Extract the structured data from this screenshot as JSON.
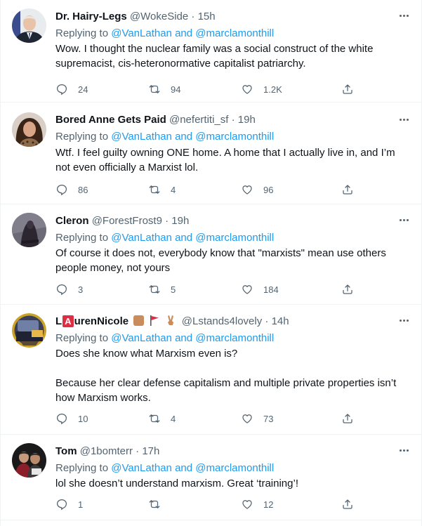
{
  "tweets": [
    {
      "display_name": "Dr. Hairy-Legs",
      "handle": "@WokeSide",
      "time": "15h",
      "replying_prefix": "Replying to",
      "reply_user1": "@VanLathan",
      "reply_and": "and",
      "reply_user2": "@marclamonthill",
      "text": [
        "Wow. I thought the nuclear family was a social construct of the white supremacist, cis-heteronormative capitalist patriarchy."
      ],
      "replies": "24",
      "retweets": "94",
      "likes": "1.2K",
      "avatar_icon": "man-in-suit-avatar"
    },
    {
      "display_name": "Bored Anne Gets Paid",
      "handle": "@nefertiti_sf",
      "time": "19h",
      "replying_prefix": "Replying to",
      "reply_user1": "@VanLathan",
      "reply_and": "and",
      "reply_user2": "@marclamonthill",
      "text": [
        "Wtf. I feel guilty owning ONE home. A home that I actually live in, and I’m not even officially a Marxist lol."
      ],
      "replies": "86",
      "retweets": "4",
      "likes": "96",
      "avatar_icon": "woman-avatar"
    },
    {
      "display_name": "Cleron",
      "handle": "@ForestFrost9",
      "time": "19h",
      "replying_prefix": "Replying to",
      "reply_user1": "@VanLathan",
      "reply_and": "and",
      "reply_user2": "@marclamonthill",
      "text": [
        "Of course it does not, everybody know that \"marxists\" mean use others people money, not yours"
      ],
      "replies": "3",
      "retweets": "5",
      "likes": "184",
      "avatar_icon": "dark-figure-avatar"
    },
    {
      "display_name_pre": "L",
      "display_name_badge": "A",
      "display_name_post": "urenNicole",
      "handle": "@Lstands4lovely",
      "time": "14h",
      "replying_prefix": "Replying to",
      "reply_user1": "@VanLathan",
      "reply_and": "and",
      "reply_user2": "@marclamonthill",
      "text": [
        "Does she know what Marxism even is?",
        "Because her clear defense capitalism and multiple private properties isn’t how Marxism works."
      ],
      "replies": "10",
      "retweets": "4",
      "likes": "73",
      "avatar_icon": "car-interior-avatar",
      "name_emojis": [
        "raised-fist-emoji",
        "red-flag-emoji",
        "victory-hand-emoji"
      ]
    },
    {
      "display_name": "Tom",
      "handle": "@1bomterr",
      "time": "17h",
      "replying_prefix": "Replying to",
      "reply_user1": "@VanLathan",
      "reply_and": "and",
      "reply_user2": "@marclamonthill",
      "text": [
        "lol she doesn’t understand marxism. Great ‘training’!"
      ],
      "replies": "1",
      "retweets": "",
      "likes": "12",
      "avatar_icon": "two-people-avatar"
    }
  ],
  "colors": {
    "link": "#1d9bf0",
    "muted": "#536471",
    "text": "#0f1419",
    "border": "#eff3f4"
  },
  "icons": {
    "reply": "reply-bubble-icon",
    "retweet": "retweet-icon",
    "like": "heart-icon",
    "share": "share-icon",
    "more": "more-dots-icon"
  },
  "separator": "·"
}
